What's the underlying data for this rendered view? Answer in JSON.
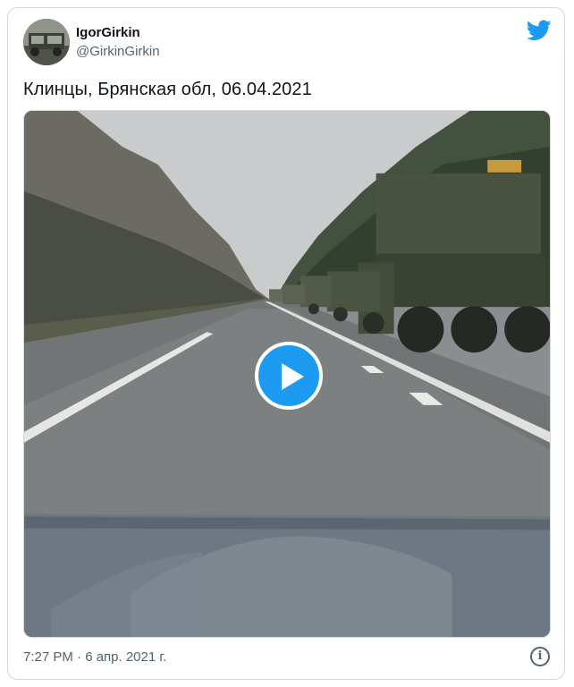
{
  "tweet": {
    "author_name": "IgorGirkin",
    "author_handle": "@GirkinGirkin",
    "text": "Клинцы, Брянская обл, 06.04.2021",
    "timestamp": "7:27 PM · 6 апр. 2021 г."
  },
  "icons": {
    "platform": "twitter-bird-icon",
    "play": "play-icon",
    "info": "info-icon"
  },
  "colors": {
    "accent": "#1d9bf0",
    "text_primary": "#0f1419",
    "text_secondary": "#536471",
    "border": "#cfd9de"
  }
}
